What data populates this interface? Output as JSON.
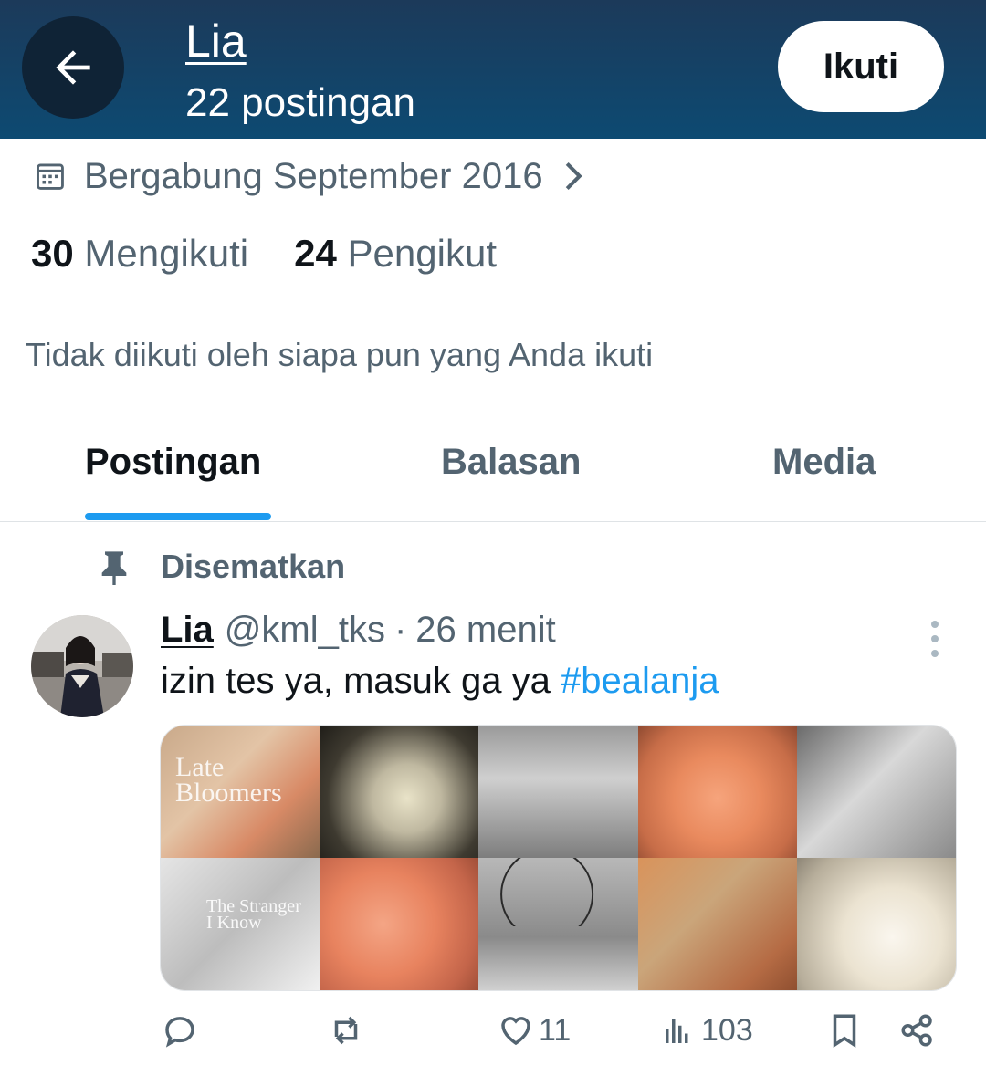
{
  "header": {
    "name": "Lia",
    "post_count": "22 postingan",
    "follow_label": "Ikuti"
  },
  "profile": {
    "joined": "Bergabung September 2016",
    "following_count": "30",
    "following_label": "Mengikuti",
    "followers_count": "24",
    "followers_label": "Pengikut",
    "not_followed_note": "Tidak diikuti oleh siapa pun yang Anda ikuti"
  },
  "tabs": [
    {
      "label": "Postingan",
      "active": true
    },
    {
      "label": "Balasan",
      "active": false
    },
    {
      "label": "Media",
      "active": false
    }
  ],
  "post": {
    "pinned_label": "Disematkan",
    "name": "Lia",
    "handle": "@kml_tks",
    "separator": "·",
    "time": "26 menit",
    "text": "izin tes ya, masuk ga ya ",
    "hashtag": "#bealanja",
    "media_texts": {
      "tile1": "Late Bloomers",
      "tile6": "The Stranger I Know"
    },
    "likes": "11",
    "views": "103"
  },
  "colors": {
    "header_bg": "#0d4a72",
    "accent": "#1d9bf0",
    "muted": "#536471"
  }
}
